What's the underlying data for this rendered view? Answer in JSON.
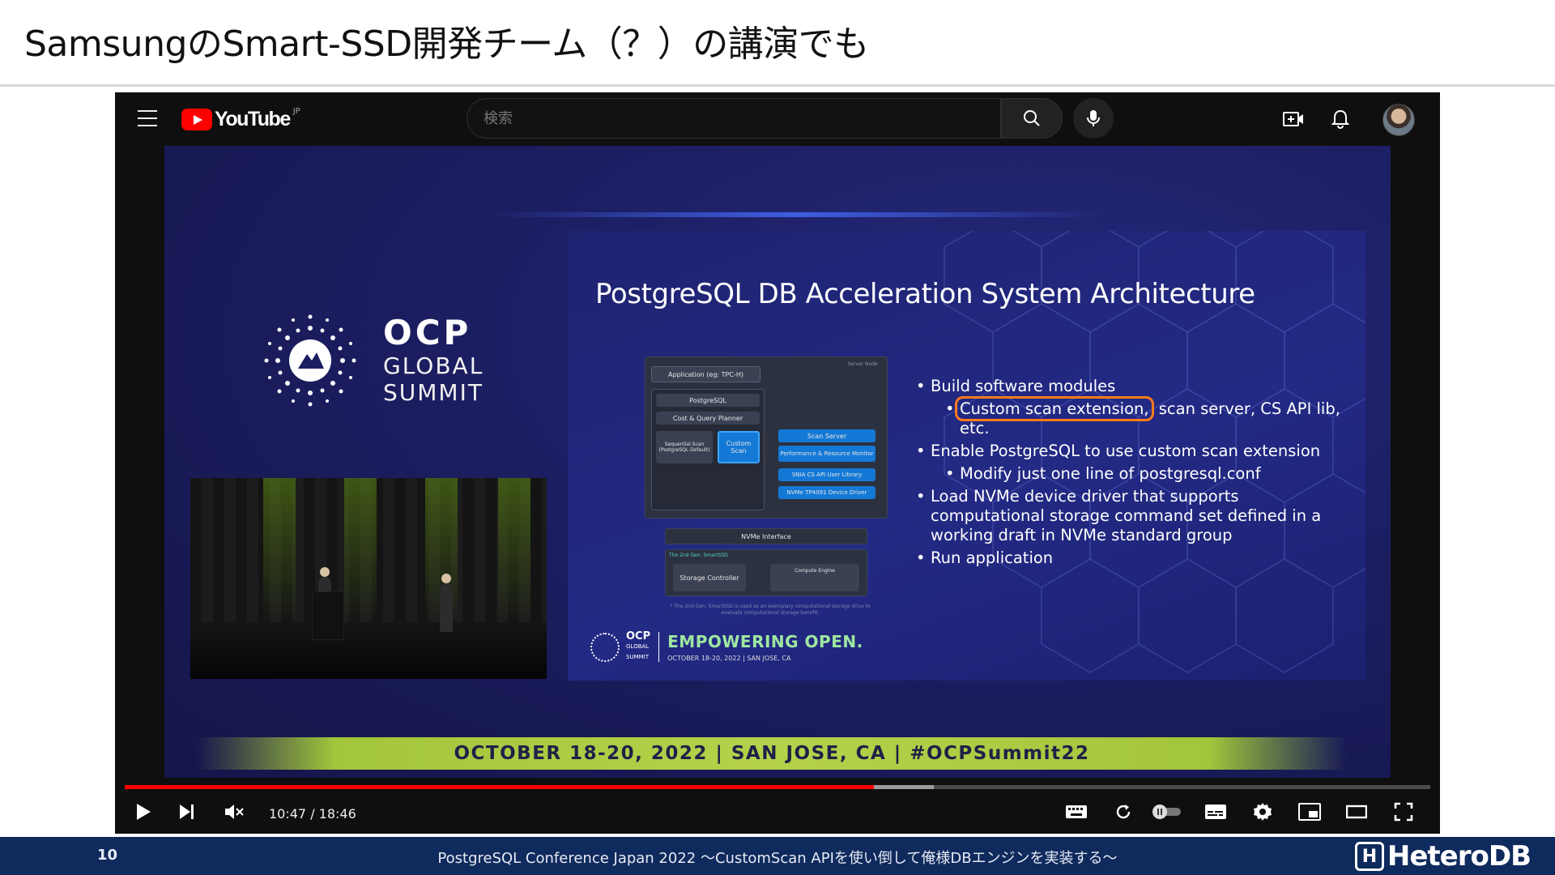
{
  "slide": {
    "title": "SamsungのSmart-SSD開発チーム（？）の講演でも",
    "page_number": "10",
    "footer_caption": "PostgreSQL Conference Japan 2022 ～CustomScan APIを使い倒して俺様DBエンジンを実装する～",
    "brand": "HeteroDB"
  },
  "youtube": {
    "logo_text": "YouTube",
    "region": "JP",
    "search_placeholder": "検索",
    "icons": [
      "menu-icon",
      "search-icon",
      "mic-icon",
      "create-video-icon",
      "bell-icon",
      "avatar"
    ]
  },
  "video_content": {
    "ocp_brand": "OCP",
    "ocp_global": "GLOBAL",
    "ocp_summit": "SUMMIT",
    "arch_title": "PostgreSQL DB Acceleration System Architecture",
    "bullets": {
      "b1": "Build software modules",
      "b1_sub_highlight": "Custom scan extension,",
      "b1_sub_rest": " scan server, CS API lib, etc.",
      "b2": "Enable PostgreSQL to use custom scan extension",
      "b2_sub": "Modify just one line of postgresql.conf",
      "b3": "Load NVMe device driver that supports computational storage command set defined in a working draft in NVMe standard group",
      "b4": "Run application"
    },
    "diagram": {
      "server_node": "Server Node",
      "application": "Application (eg: TPC-H)",
      "postgresql": "PostgreSQL",
      "planner": "Cost & Query Planner",
      "seq_scan": "Sequential Scan (PostgreSQL Default)",
      "custom_scan": "Custom Scan",
      "scan_server": "Scan Server",
      "perf_monitor": "Performance & Resource Monitor",
      "snia_lib": "SNIA CS API User Library",
      "nvme_driver": "NVMe TP4091 Device Driver",
      "nvme_interface": "NVMe Interface",
      "smartssd": "The 2nd Gen. SmartSSD",
      "storage_controller": "Storage Controller",
      "compute_engine": "Compute Engine",
      "note": "* The 2nd Gen. SmartSSD is used as an exemplary computational storage drive to evaluate computational storage benefit."
    },
    "footer_empowering": "EMPOWERING OPEN.",
    "footer_date": "OCTOBER 18-20, 2022 | SAN JOSE, CA",
    "banner": "OCTOBER 18-20, 2022   |   SAN JOSE, CA   |   #OCPSummit22"
  },
  "player": {
    "time": "10:47 / 18:46",
    "played_fraction": 0.574,
    "loaded_fraction": 0.62,
    "controls": [
      "play-button",
      "next-button",
      "mute-button",
      "keyboard-icon",
      "loop-icon",
      "autoplay-toggle",
      "captions-button",
      "settings-button",
      "miniplayer-button",
      "theater-button",
      "fullscreen-button"
    ]
  },
  "colors": {
    "youtube_red": "#ff0000",
    "slide_bg": "#1f2370",
    "highlight": "#ff7a1a",
    "footer_bar": "#0f2a5c",
    "banner_green": "#b5d24a"
  }
}
